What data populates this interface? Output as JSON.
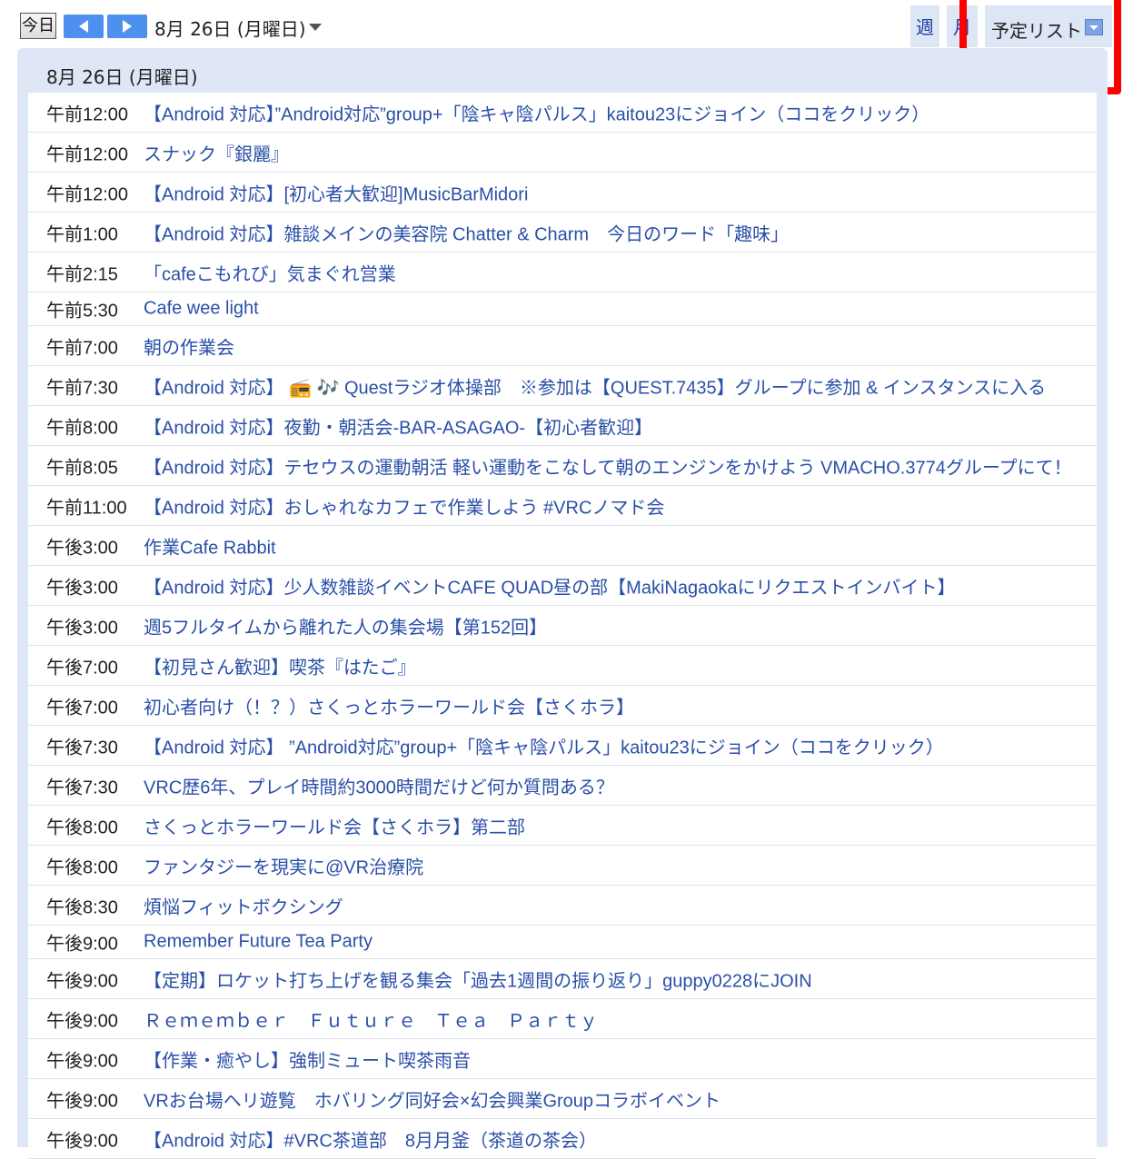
{
  "toolbar": {
    "today_label": "今日",
    "date_label": "8月 26日 (月曜日)",
    "week_tab": "週",
    "month_tab": "月",
    "agenda_tab": "予定リスト"
  },
  "colors": {
    "accent": "#4d90f0",
    "panel_bg": "#dfe7f6",
    "link": "#2a4fa8",
    "highlight": "#ff0000"
  },
  "agenda": {
    "day_header": "8月 26日 (月曜日)",
    "events": [
      {
        "time": "午前12:00",
        "title": "【Android 対応】”Android対応”group+「陰キャ陰パルス」kaitou23にジョイン（ココをクリック）"
      },
      {
        "time": "午前12:00",
        "title": "スナック『銀麗』"
      },
      {
        "time": "午前12:00",
        "title": "【Android 対応】[初心者大歓迎]MusicBarMidori"
      },
      {
        "time": "午前1:00",
        "title": "【Android 対応】雑談メインの美容院 Chatter & Charm　今日のワード「趣味」"
      },
      {
        "time": "午前2:15",
        "title": "「cafeこもれび」気まぐれ営業"
      },
      {
        "time": "午前5:30",
        "title": "Cafe wee light"
      },
      {
        "time": "午前7:00",
        "title": "朝の作業会"
      },
      {
        "time": "午前7:30",
        "title": "【Android 対応】 📻 🎶 Questラジオ体操部　※参加は【QUEST.7435】グループに参加 & インスタンスに入る"
      },
      {
        "time": "午前8:00",
        "title": "【Android 対応】夜勤・朝活会-BAR-ASAGAO-【初心者歓迎】"
      },
      {
        "time": "午前8:05",
        "title": "【Android 対応】テセウスの運動朝活 軽い運動をこなして朝のエンジンをかけよう VMACHO.3774グループにて！"
      },
      {
        "time": "午前11:00",
        "title": "【Android 対応】おしゃれなカフェで作業しよう #VRCノマド会"
      },
      {
        "time": "午後3:00",
        "title": "作業Cafe Rabbit"
      },
      {
        "time": "午後3:00",
        "title": "【Android 対応】少人数雑談イベントCAFE QUAD昼の部【MakiNagaokaにリクエストインバイト】"
      },
      {
        "time": "午後3:00",
        "title": "週5フルタイムから離れた人の集会場【第152回】"
      },
      {
        "time": "午後7:00",
        "title": "【初見さん歓迎】喫茶『はたご』"
      },
      {
        "time": "午後7:00",
        "title": "初心者向け（！？）さくっとホラーワールド会【さくホラ】"
      },
      {
        "time": "午後7:30",
        "title": "【Android 対応】 ”Android対応”group+「陰キャ陰パルス」kaitou23にジョイン（ココをクリック）"
      },
      {
        "time": "午後7:30",
        "title": "VRC歴6年、プレイ時間約3000時間だけど何か質問ある？"
      },
      {
        "time": "午後8:00",
        "title": "さくっとホラーワールド会【さくホラ】第二部"
      },
      {
        "time": "午後8:00",
        "title": "ファンタジーを現実に@VR治療院"
      },
      {
        "time": "午後8:30",
        "title": "煩悩フィットボクシング"
      },
      {
        "time": "午後9:00",
        "title": "Remember Future Tea Party"
      },
      {
        "time": "午後9:00",
        "title": "【定期】ロケット打ち上げを観る集会「過去1週間の振り返り」guppy0228にJOIN"
      },
      {
        "time": "午後9:00",
        "title": "Ｒｅｍｅｍｂｅｒ　Ｆｕｔｕｒｅ　Ｔｅａ　Ｐａｒｔｙ"
      },
      {
        "time": "午後9:00",
        "title": "【作業・癒やし】強制ミュート喫茶雨音"
      },
      {
        "time": "午後9:00",
        "title": "VRお台場ヘリ遊覧　ホバリング同好会×幻会興業Groupコラボイベント"
      },
      {
        "time": "午後9:00",
        "title": "【Android 対応】#VRC茶道部　8月月釜（茶道の茶会）"
      }
    ]
  }
}
